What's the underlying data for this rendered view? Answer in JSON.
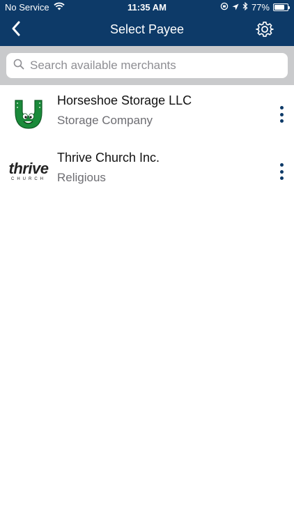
{
  "status_bar": {
    "carrier": "No Service",
    "time": "11:35 AM",
    "battery": "77%",
    "battery_level": 0.77
  },
  "navbar": {
    "title": "Select Payee",
    "back_icon": "chevron-left-icon",
    "settings_icon": "gear-icon"
  },
  "search": {
    "placeholder": "Search available merchants",
    "value": ""
  },
  "merchants": [
    {
      "name": "Horseshoe Storage LLC",
      "category": "Storage Company",
      "logo": "horseshoe-logo"
    },
    {
      "name": "Thrive Church Inc.",
      "category": "Religious",
      "logo": "thrive-church-logo",
      "logo_text": "thrive",
      "logo_subtext": "CHURCH"
    }
  ],
  "colors": {
    "header": "#0d3a68",
    "search_bar_bg": "#c9cacc",
    "accent": "#0d3a68",
    "logo_green": "#1a8a3a"
  }
}
